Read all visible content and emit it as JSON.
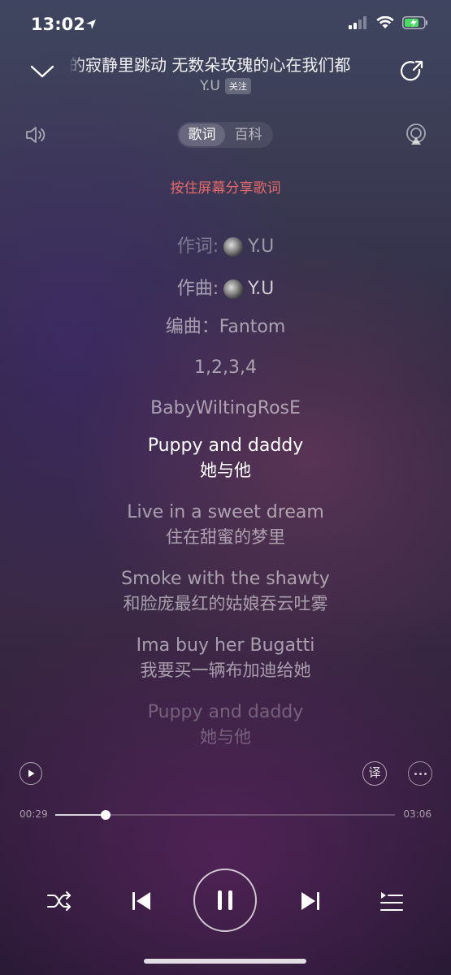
{
  "status_bar": {
    "time": "13:02"
  },
  "header": {
    "title_scroll": "的寂静里跳动      无数朵玫瑰的心在我们都",
    "artist": "Y.U",
    "follow_label": "关注"
  },
  "tabs": [
    {
      "label": "歌词",
      "active": true
    },
    {
      "label": "百科",
      "active": false
    }
  ],
  "share_hint": "按住屏幕分享歌词",
  "lyrics": {
    "lyricist_label": "作词:",
    "lyricist": "Y.U",
    "composer_label": "作曲:",
    "composer": "Y.U",
    "arranger": "编曲：Fantom",
    "line_1": "1,2,3,4",
    "line_2": "BabyWiltingRosE",
    "pairs": [
      {
        "en": "Puppy and daddy",
        "cn": "她与他",
        "state": "current"
      },
      {
        "en": "Live in a sweet dream",
        "cn": "住在甜蜜的梦里",
        "state": "normal"
      },
      {
        "en": "Smoke with the shawty",
        "cn": "和脸庞最红的姑娘吞云吐雾",
        "state": "normal"
      },
      {
        "en": "Ima buy her Bugatti",
        "cn": "我要买一辆布加迪给她",
        "state": "normal"
      },
      {
        "en": "Puppy and daddy",
        "cn": "她与他",
        "state": "faded"
      }
    ]
  },
  "controls": {
    "translate_label": "译"
  },
  "progress": {
    "current": "00:29",
    "total": "03:06",
    "fraction": 0.148
  },
  "icons": {
    "back": "chevron-down-icon",
    "share": "share-icon",
    "volume": "volume-icon",
    "airplay": "airplay-icon",
    "shuffle": "shuffle-icon",
    "previous": "previous-icon",
    "pause": "pause-icon",
    "next": "next-icon",
    "playlist": "playlist-icon"
  },
  "colors": {
    "share_hint": "#e56a6a"
  }
}
